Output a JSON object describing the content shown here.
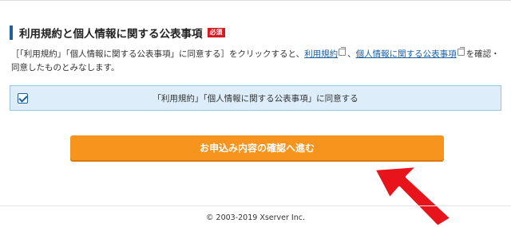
{
  "section": {
    "title": "利用規約と個人情報に関する公表事項",
    "required_badge": "必須",
    "consent_prefix": "［「利用規約」「個人情報に関する公表事項」に同意する］をクリックすると、",
    "link_terms": "利用規約",
    "separator": "、",
    "link_privacy": "個人情報に関する公表事項",
    "consent_suffix": "を確認・同意したものとみなします。"
  },
  "agree": {
    "label": "「利用規約」「個人情報に関する公表事項」に同意する",
    "checked": true
  },
  "submit": {
    "label": "お申込み内容の確認へ進む"
  },
  "footer": {
    "copyright": "© 2003-2019 Xserver Inc."
  },
  "colors": {
    "accent": "#1f5f9a",
    "badge": "#d71920",
    "button": "#f7941d",
    "agree_bg": "#ddeefa",
    "arrow": "#e8141c"
  },
  "icons": [
    "external-link-icon",
    "checkbox-checked-icon",
    "pointer-arrow-icon"
  ]
}
